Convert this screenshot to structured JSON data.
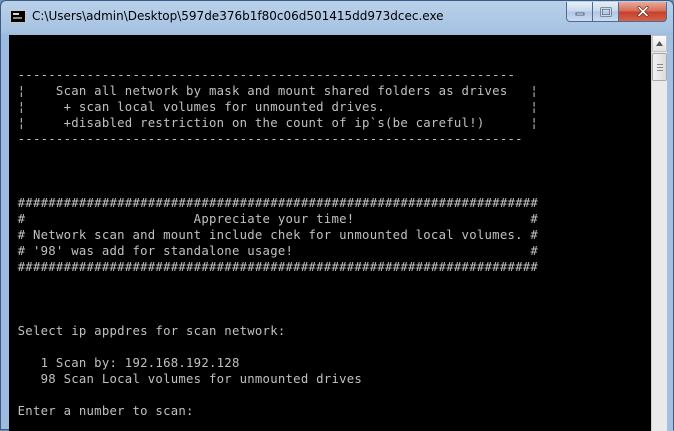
{
  "window": {
    "title": "C:\\Users\\admin\\Desktop\\597de376b1f80c06d501415dd973dcec.exe",
    "icon": "console-app-icon",
    "controls": {
      "minimize": "minimize-icon",
      "maximize": "maximize-icon",
      "close": "close-icon"
    }
  },
  "console": {
    "lines": [
      "",
      "",
      " -----------------------------------------------------------------",
      " ¦    Scan all network by mask and mount shared folders as drives   ¦",
      " ¦     + scan local volumes for unmounted drives.                   ¦",
      " ¦     +disabled restriction on the count of ip`s(be careful!)      ¦",
      " ------------------------------------------------------------------",
      "",
      "",
      "",
      " ####################################################################",
      " #                      Appreciate your time!                       #",
      " # Network scan and mount include chek for unmounted local volumes. #",
      " # '98' was add for standalone usage!                               #",
      " ####################################################################",
      "",
      "",
      "",
      " Select ip appdres for scan network:",
      "",
      "    1 Scan by: 192.168.192.128",
      "    98 Scan Local volumes for unmounted drives",
      "",
      " Enter a number to scan:"
    ]
  },
  "colors": {
    "console_bg": "#000000",
    "console_text": "#c0c0c0",
    "titlebar": "#b9d1ea",
    "close_button": "#c4402a"
  }
}
